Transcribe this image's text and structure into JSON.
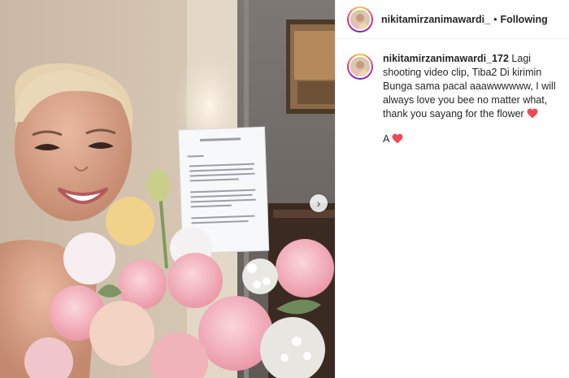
{
  "header": {
    "username": "nikitamirzanimawardi_",
    "separator": "•",
    "follow_status": "Following"
  },
  "caption": {
    "username": "nikitamirzanimawardi_172",
    "text": "Lagi shooting video clip, Tiba2 Di kirimin Bunga sama pacal aaawwwwww, I will always love you bee no matter what, thank you sayang for the flower",
    "second_line": "A"
  },
  "media": {
    "next_arrow": "›"
  },
  "colors": {
    "heart": "#ed4956",
    "text": "#262626"
  },
  "icons": [
    "heart-icon",
    "chevron-right-icon",
    "avatar"
  ]
}
